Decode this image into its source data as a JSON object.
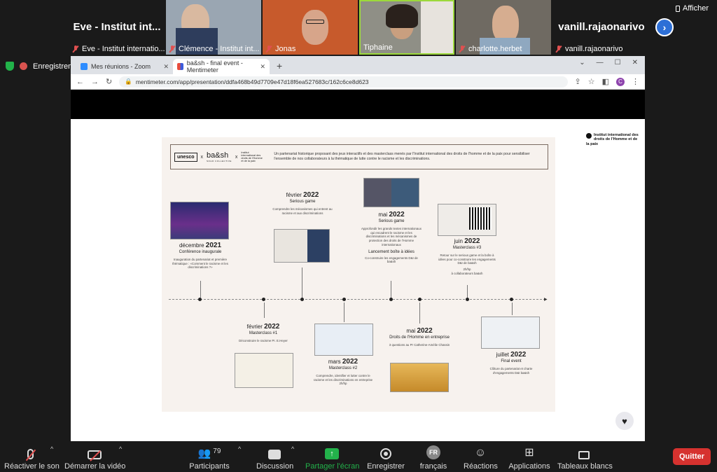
{
  "meeting": {
    "afficher_label": "Afficher",
    "participants": [
      {
        "big": "Eve - Institut int...",
        "name": "Eve - Institut internatio..."
      },
      {
        "name": "Clémence - Institut int..."
      },
      {
        "name": "Jonas"
      },
      {
        "name": "Tiphaine"
      },
      {
        "name": "charlotte.herbet"
      },
      {
        "big": "vanill.rajaonarivo",
        "name": "vanill.rajaonarivo"
      }
    ],
    "recording_label": "Enregistrem..."
  },
  "browser": {
    "tabs": [
      {
        "label": "Mes réunions - Zoom"
      },
      {
        "label": "ba&sh - final event - Mentimeter"
      }
    ],
    "url": "mentimeter.com/app/presentation/ddfa468b49d7709e47d18f6ea527683c/162c6ce8d623",
    "avatar_letter": "C"
  },
  "slide": {
    "brand": {
      "unesco": "unesco",
      "bash": "ba&sh",
      "sep": "x",
      "bash_sub": "SOHO COLLECTIVE",
      "iidh_small": "Institut international des droits de l'Homme et de la paix"
    },
    "iidh_logo": "Institut international des droits de l'Homme et de la paix",
    "banner_text": "Un partenariat historique proposant des jeux interactifs et des masterclass menés par l'Institut international des droits de l'homme et de la paix pour sensibiliser l'ensemble de nos collaborateurs à la thématique de lutte contre le racisme et les discriminations.",
    "events": [
      {
        "month": "décembre",
        "year": "2021",
        "title": "Conférence inaugurale",
        "desc": "Inauguration du partenariat et première thématique : «Comment le racisme et les discriminations ?»"
      },
      {
        "month": "février",
        "year": "2022",
        "title": "Serious game",
        "desc": "Comprendre les mécanismes qui entrent au racisme et aux discriminations"
      },
      {
        "month": "mai",
        "year": "2022",
        "title": "Serious game",
        "desc": "Approfondir les grands textes internationaux qui encadrent le racisme et les discriminations et les mécanismes de protection des droits de l'Homme internationaux",
        "extra1": "Lancement boîte à idées",
        "extra2": "Co-construire les engagements D&I de ba&sh"
      },
      {
        "month": "juin",
        "year": "2022",
        "title": "Masterclass #3",
        "desc": "Retour sur le serious game et la boîte à idées pour co-construire les engagements D&I de ba&sh",
        "extra1": "2h/hp",
        "extra2": "à collaborateurs ba&sh"
      },
      {
        "month": "février",
        "year": "2022",
        "title": "Masterclass #1",
        "desc": "Déconstruire le racisme Pr. E.Heyer"
      },
      {
        "month": "mars",
        "year": "2022",
        "title": "Masterclass #2",
        "desc": "Comprendre, identifier et lutter contre le racisme et les discriminations en entreprise 2h/hp"
      },
      {
        "month": "mai",
        "year": "2022",
        "title": "Droits de l'Homme en entreprise",
        "desc": "3 questions au Pr Catherine-Amélie Chassin"
      },
      {
        "month": "juillet",
        "year": "2022",
        "title": "Final event",
        "desc": "Clôture du partenariat et charte d'engagements D&I ba&sh"
      }
    ]
  },
  "toolbar": {
    "items": [
      {
        "label": "Réactiver le son"
      },
      {
        "label": "Démarrer la vidéo"
      },
      {
        "label": "Participants",
        "count": "79"
      },
      {
        "label": "Discussion"
      },
      {
        "label": "Partager l'écran"
      },
      {
        "label": "Enregistrer"
      },
      {
        "label": "français",
        "badge": "FR"
      },
      {
        "label": "Réactions"
      },
      {
        "label": "Applications"
      },
      {
        "label": "Tableaux blancs"
      }
    ],
    "quit_label": "Quitter"
  }
}
